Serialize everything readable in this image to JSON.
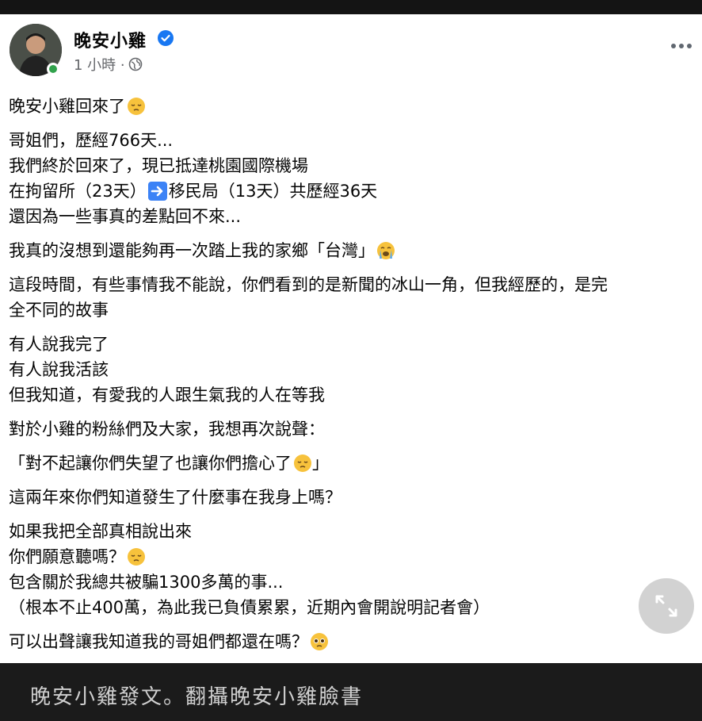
{
  "header": {
    "name": "晚安小雞",
    "time": "1 小時 ·"
  },
  "post": {
    "p1": [
      "晚安小雞回來了"
    ],
    "p2": [
      "哥姐們，歷經766天...",
      "我們終於回來了，現已抵達桃園國際機場"
    ],
    "p2_line3_a": "在拘留所（23天）",
    "p2_line3_b": "移民局（13天）共歷經36天",
    "p2_line4": "還因為一些事真的差點回不來...",
    "p3": "我真的沒想到還能夠再一次踏上我的家鄉「台灣」",
    "p4_l1": "這段時間，有些事情我不能說，你們看到的是新聞的冰山一角，但我經歷的，是完",
    "p4_l2": "全不同的故事",
    "p5": [
      "有人說我完了",
      "有人說我活該",
      "但我知道，有愛我的人跟生氣我的人在等我"
    ],
    "p6": "對於小雞的粉絲們及大家，我想再次說聲：",
    "p7_a": "「對不起讓你們失望了也讓你們擔心了",
    "p7_b": "」",
    "p8": "這兩年來你們知道發生了什麼事在我身上嗎？",
    "p9_l1": "如果我把全部真相說出來",
    "p9_l2": "你們願意聽嗎？",
    "p9_l3": "包含關於我總共被騙1300多萬的事...",
    "p9_l4": "（根本不止400萬，為此我已負債累累，近期內會開說明記者會）",
    "p10": "可以出聲讓我知道我的哥姐們都還在嗎？"
  },
  "caption": "晚安小雞發文。翻攝晚安小雞臉書",
  "colors": {
    "verified": "#1877f2",
    "online": "#31a24c",
    "text": "#050505",
    "meta": "#65676b"
  }
}
